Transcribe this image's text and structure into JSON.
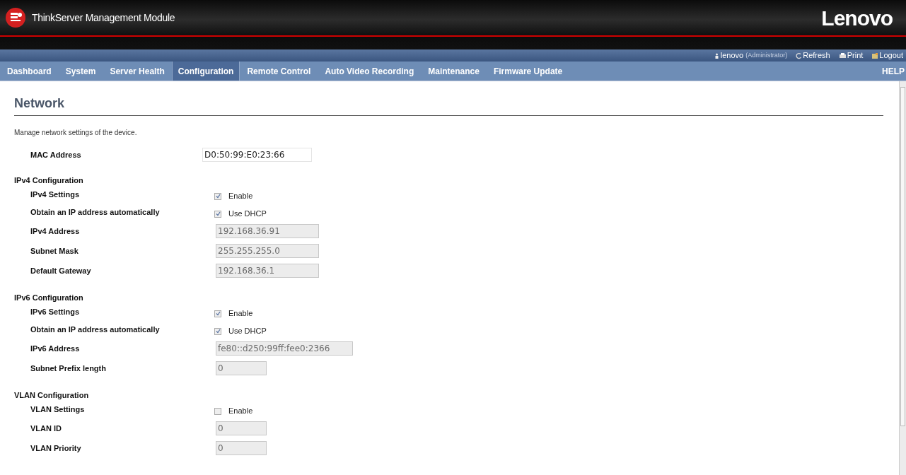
{
  "header": {
    "title": "ThinkServer Management Module",
    "brand": "Lenovo"
  },
  "user_bar": {
    "user": "lenovo",
    "role": "(Administrator)",
    "links": [
      {
        "label": "Refresh",
        "kind": "refresh"
      },
      {
        "label": "Print",
        "kind": "print"
      },
      {
        "label": "Logout",
        "kind": "logout"
      }
    ]
  },
  "nav": {
    "items": [
      {
        "label": "Dashboard",
        "selected": false
      },
      {
        "label": "System",
        "selected": false
      },
      {
        "label": "Server Health",
        "selected": false
      },
      {
        "label": "Configuration",
        "selected": true
      },
      {
        "label": "Remote Control",
        "selected": false
      },
      {
        "label": "Auto Video Recording",
        "selected": false
      },
      {
        "label": "Maintenance",
        "selected": false
      },
      {
        "label": "Firmware Update",
        "selected": false
      }
    ],
    "help": "HELP"
  },
  "page": {
    "title": "Network",
    "description": "Manage network settings of the device."
  },
  "sections": [
    {
      "rows": [
        {
          "kind": "field",
          "label": "MAC Address",
          "value": "D0:50:99:E0:23:66",
          "disabled": false
        }
      ]
    },
    {
      "title": "IPv4 Configuration",
      "rows": [
        {
          "kind": "checkbox",
          "label": "IPv4 Settings",
          "option": "Enable",
          "checked": true
        },
        {
          "kind": "checkbox",
          "label": "Obtain an IP address automatically",
          "option": "Use DHCP",
          "checked": true
        },
        {
          "kind": "field",
          "label": "IPv4 Address",
          "value": "192.168.36.91",
          "disabled": true
        },
        {
          "kind": "field",
          "label": "Subnet Mask",
          "value": "255.255.255.0",
          "disabled": true
        },
        {
          "kind": "field",
          "label": "Default Gateway",
          "value": "192.168.36.1",
          "disabled": true
        }
      ]
    },
    {
      "title": "IPv6 Configuration",
      "rows": [
        {
          "kind": "checkbox",
          "label": "IPv6 Settings",
          "option": "Enable",
          "checked": true
        },
        {
          "kind": "checkbox",
          "label": "Obtain an IP address automatically",
          "option": "Use DHCP",
          "checked": true
        },
        {
          "kind": "field",
          "label": "IPv6 Address",
          "value": "fe80::d250:99ff:fee0:2366",
          "disabled": true
        },
        {
          "kind": "field",
          "label": "Subnet Prefix length",
          "value": "0",
          "disabled": true
        }
      ]
    },
    {
      "title": "VLAN Configuration",
      "rows": [
        {
          "kind": "checkbox",
          "label": "VLAN Settings",
          "option": "Enable",
          "checked": false
        },
        {
          "kind": "field",
          "label": "VLAN ID",
          "value": "0",
          "disabled": true
        },
        {
          "kind": "field",
          "label": "VLAN Priority",
          "value": "0",
          "disabled": true
        }
      ]
    }
  ]
}
